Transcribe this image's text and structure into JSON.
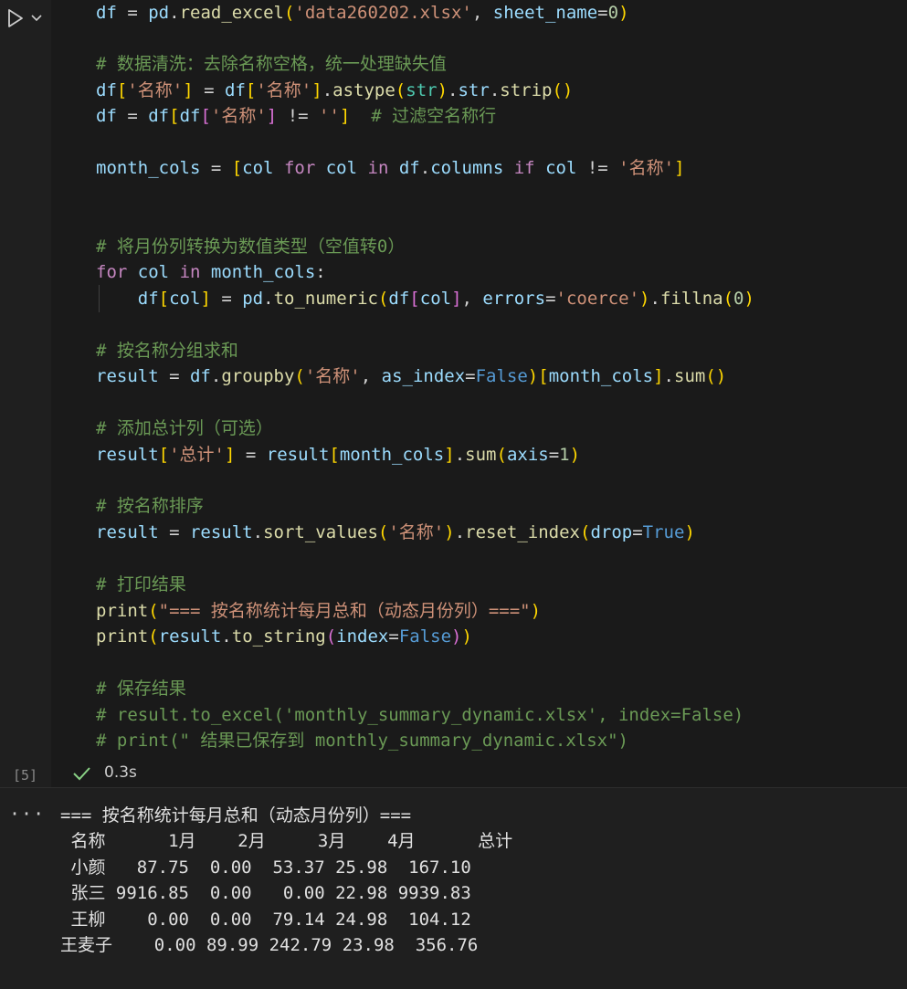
{
  "cell": {
    "run_label": "Run cell",
    "execution_count": "[5]",
    "status_time": "0.3s",
    "status": "success"
  },
  "code": {
    "read_file": "'data260202.xlsx'",
    "comment_clean": "# 数据清洗：去除名称空格，统一处理缺失值",
    "name_col": "'名称'",
    "empty_str": "''",
    "comment_filter": "# 过滤空名称行",
    "comment_convert": "# 将月份列转换为数值类型（空值转0）",
    "coerce": "'coerce'",
    "comment_group": "# 按名称分组求和",
    "comment_total": "# 添加总计列（可选）",
    "total_col": "'总计'",
    "comment_sort": "# 按名称排序",
    "comment_print": "# 打印结果",
    "print_title": "\"=== 按名称统计每月总和（动态月份列）===\"",
    "comment_save": "# 保存结果",
    "comment_excel": "# result.to_excel('monthly_summary_dynamic.xlsx', index=False)",
    "comment_print_saved": "# print(\" 结果已保存到 monthly_summary_dynamic.xlsx\")"
  },
  "output": {
    "more_label": "···",
    "lines": [
      "=== 按名称统计每月总和（动态月份列）===",
      " 名称      1月    2月     3月    4月      总计",
      " 小颜   87.75  0.00  53.37 25.98  167.10",
      " 张三 9916.85  0.00   0.00 22.98 9939.83",
      " 王柳    0.00  0.00  79.14 24.98  104.12",
      "王麦子    0.00 89.99 242.79 23.98  356.76"
    ]
  },
  "colors": {
    "editor_bg": "#1a1a1a",
    "comment": "#6a9955",
    "string": "#ce9178",
    "keyword": "#c586c0",
    "success": "#89d185"
  }
}
